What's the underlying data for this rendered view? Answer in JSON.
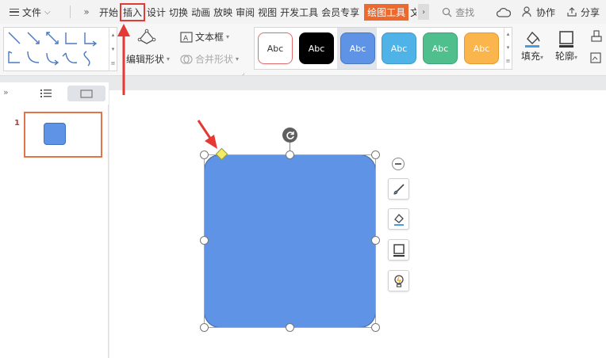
{
  "menubar": {
    "file_label": "文件",
    "tabs": [
      {
        "label": "开始"
      },
      {
        "label": "插入"
      },
      {
        "label": "设计"
      },
      {
        "label": "切换"
      },
      {
        "label": "动画"
      },
      {
        "label": "放映"
      },
      {
        "label": "审阅"
      },
      {
        "label": "视图"
      },
      {
        "label": "开发工具"
      },
      {
        "label": "会员专享"
      },
      {
        "label": "绘图工具"
      },
      {
        "label": "文"
      }
    ],
    "search_label": "查找",
    "collab_label": "协作",
    "share_label": "分享"
  },
  "ribbon": {
    "edit_shape_label": "编辑形状",
    "textbox_label": "文本框",
    "merge_shape_label": "合并形状",
    "style_presets": [
      {
        "label": "Abc",
        "fill": "#ffffff",
        "border": "#e06a6a",
        "text": "#333333"
      },
      {
        "label": "Abc",
        "fill": "#000000",
        "border": "#000000",
        "text": "#ffffff"
      },
      {
        "label": "Abc",
        "fill": "#5e93e6",
        "border": "#4a78c0",
        "text": "#ffffff"
      },
      {
        "label": "Abc",
        "fill": "#4fb3e8",
        "border": "#3d9bcc",
        "text": "#ffffff"
      },
      {
        "label": "Abc",
        "fill": "#4fc08d",
        "border": "#3aa574",
        "text": "#ffffff"
      },
      {
        "label": "Abc",
        "fill": "#fbb54d",
        "border": "#e49a2c",
        "text": "#ffffff"
      }
    ],
    "fill_label": "填充",
    "outline_label": "轮廓"
  },
  "slides": {
    "thumbnail_number": "1"
  },
  "colors": {
    "shape_fill": "#5e93e6",
    "accent_orange": "#ec6a2e",
    "annotation_red": "#e53935"
  }
}
